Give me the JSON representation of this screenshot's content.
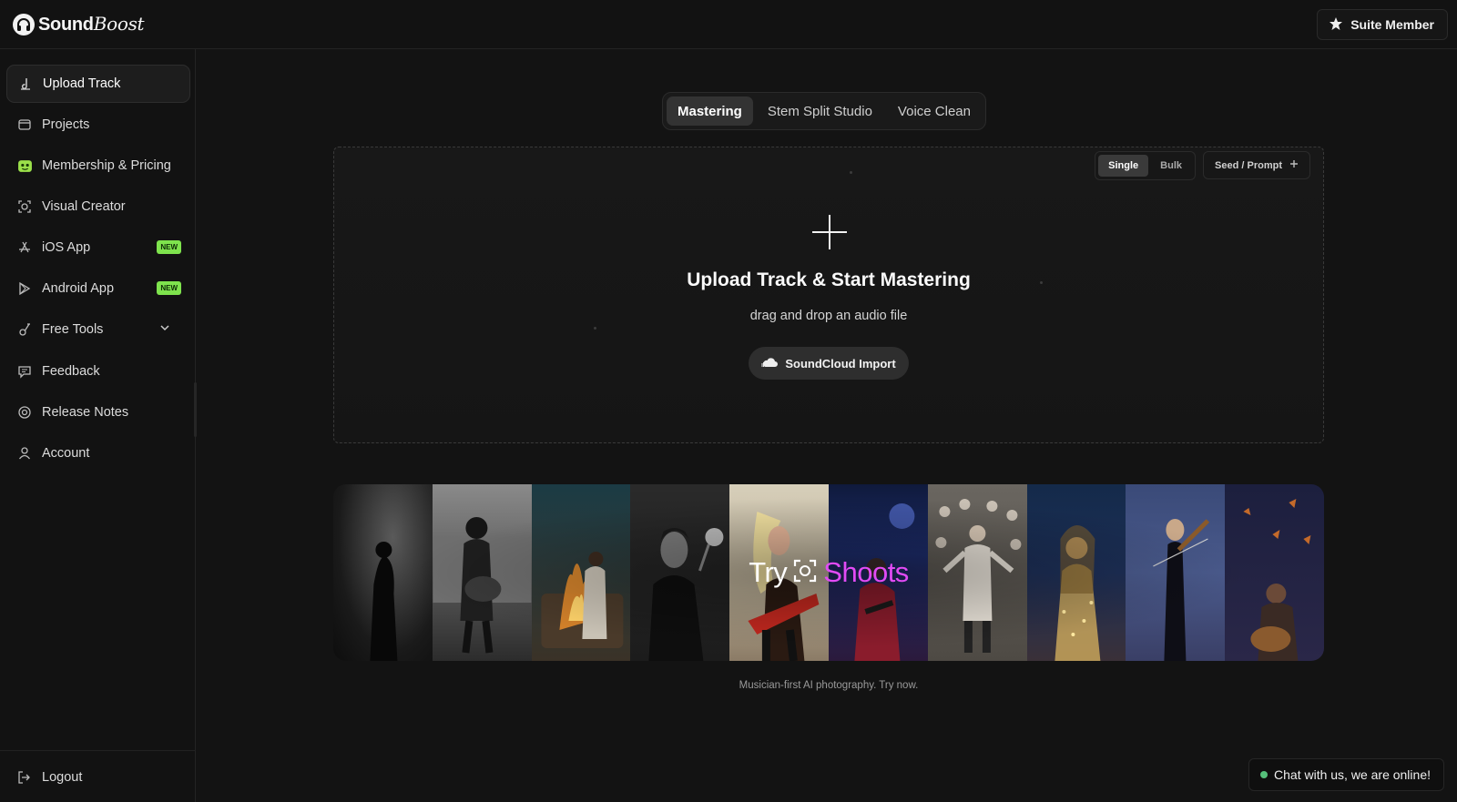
{
  "app": {
    "logo_text_a": "Sound",
    "logo_text_b": "Boost",
    "member_label": "Suite Member"
  },
  "sidebar": {
    "items": [
      {
        "label": "Upload Track",
        "icon": "music-note-icon"
      },
      {
        "label": "Projects",
        "icon": "folder-icon"
      },
      {
        "label": "Membership & Pricing",
        "icon": "membership-badge-icon"
      },
      {
        "label": "Visual Creator",
        "icon": "focus-frame-icon"
      },
      {
        "label": "iOS App",
        "icon": "app-store-icon",
        "badge": "NEW"
      },
      {
        "label": "Android App",
        "icon": "play-store-icon",
        "badge": "NEW"
      },
      {
        "label": "Free Tools",
        "icon": "tools-icon"
      },
      {
        "label": "Feedback",
        "icon": "chat-icon"
      },
      {
        "label": "Release Notes",
        "icon": "release-icon"
      },
      {
        "label": "Account",
        "icon": "user-icon"
      }
    ],
    "logout_label": "Logout"
  },
  "tabs": [
    "Mastering",
    "Stem Split Studio",
    "Voice Clean"
  ],
  "upload": {
    "mode_single": "Single",
    "mode_bulk": "Bulk",
    "seed_label": "Seed / Prompt",
    "title": "Upload Track & Start Mastering",
    "subtitle": "drag and drop an audio file",
    "soundcloud_label": "SoundCloud Import"
  },
  "banner": {
    "try_label": "Try",
    "shoots_label": "Shoots",
    "caption": "Musician-first AI photography. Try now."
  },
  "chat": {
    "label": "Chat with us, we are online!"
  },
  "colors": {
    "accent_green": "#7ee34d",
    "accent_magenta": "#e24bf5",
    "online_dot": "#55c07a",
    "background": "#131313"
  }
}
